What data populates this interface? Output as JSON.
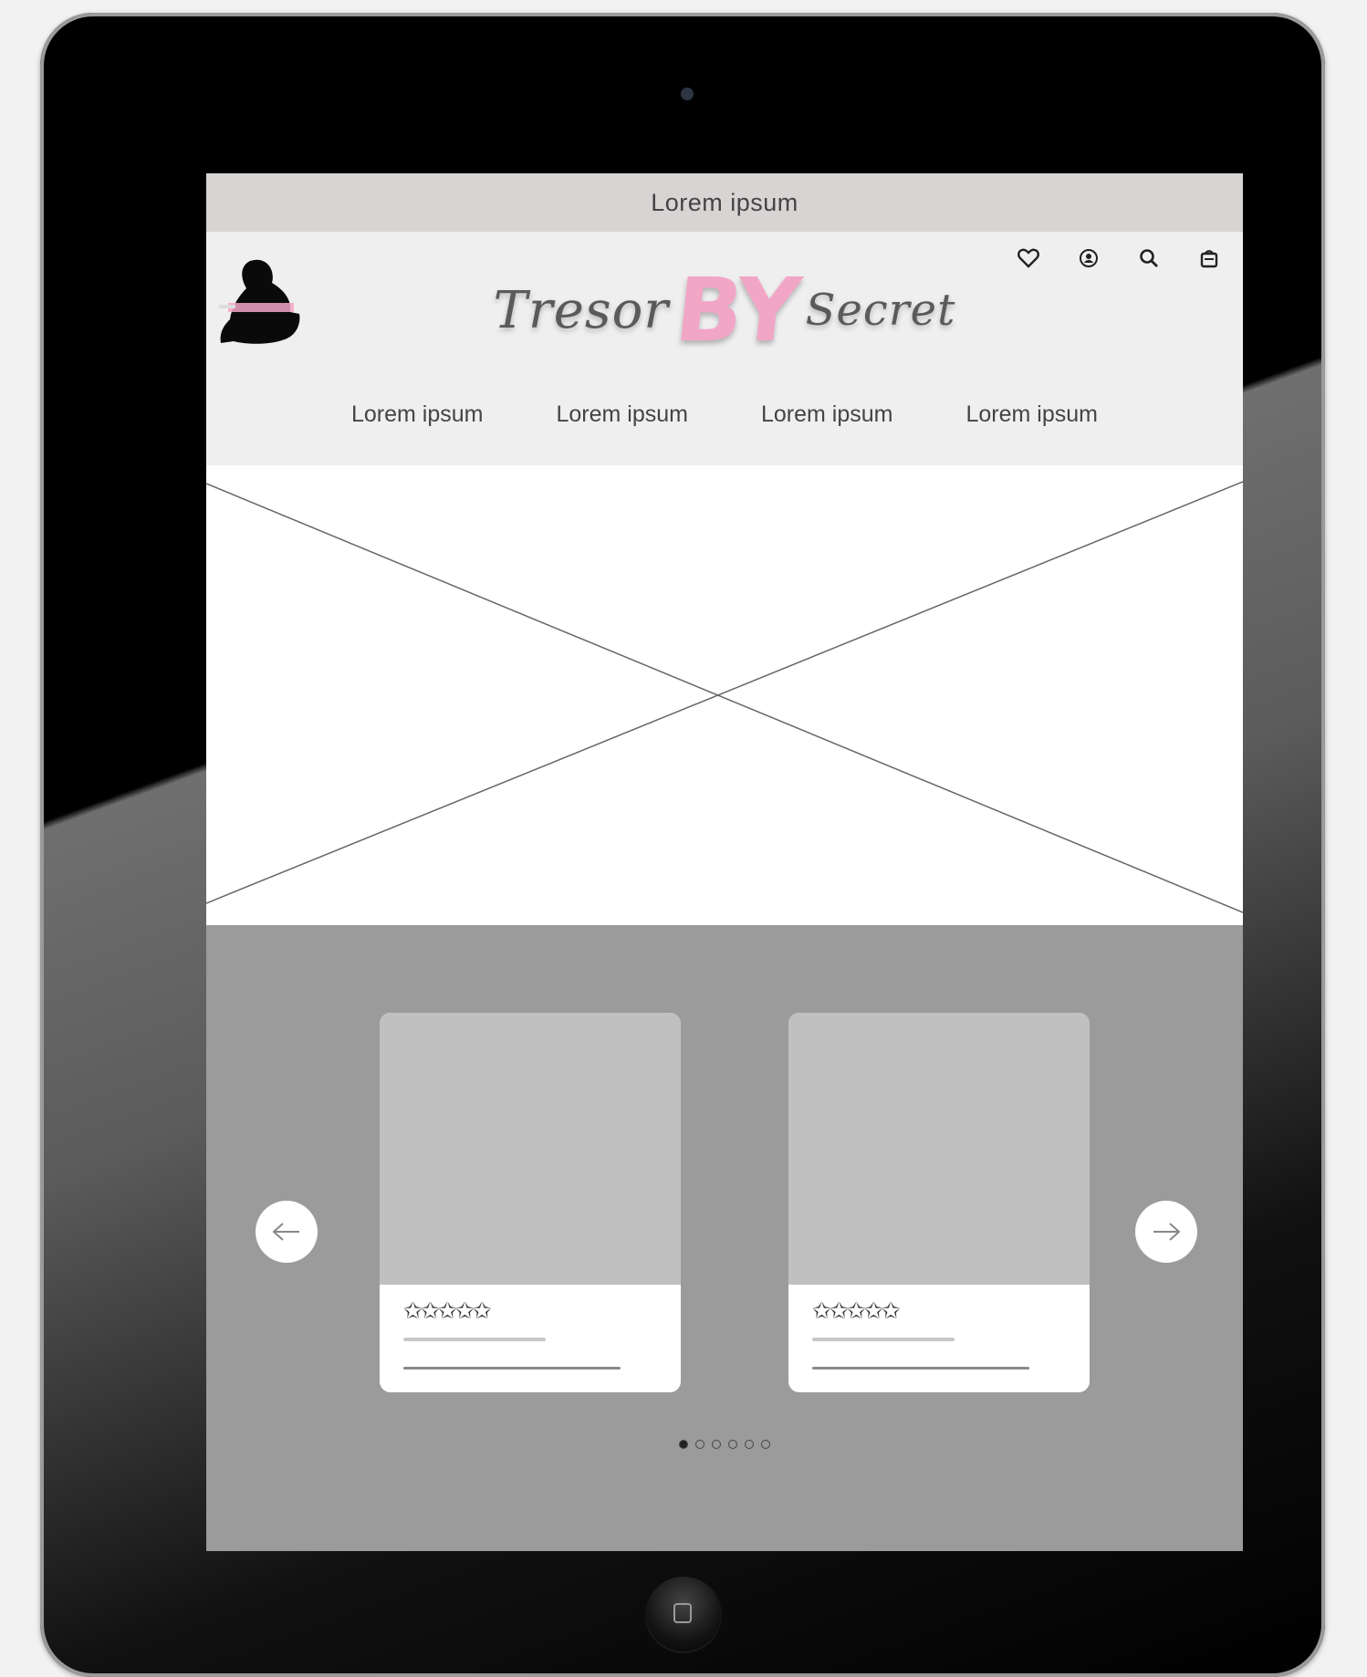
{
  "announcement": {
    "text": "Lorem ipsum"
  },
  "brand": {
    "part1": "Tresor",
    "part2": "BY",
    "part3": "Secret",
    "accent_color": "#f2a6c6"
  },
  "header_icons": [
    "heart-icon",
    "user-icon",
    "search-icon",
    "bag-icon"
  ],
  "nav": {
    "items": [
      {
        "label": "Lorem ipsum"
      },
      {
        "label": "Lorem ipsum"
      },
      {
        "label": "Lorem ipsum"
      },
      {
        "label": "Lorem ipsum"
      }
    ]
  },
  "carousel": {
    "cards": [
      {
        "stars": "✩✩✩✩✩"
      },
      {
        "stars": "✩✩✩✩✩"
      }
    ],
    "dots_total": 6,
    "active_dot": 1
  }
}
